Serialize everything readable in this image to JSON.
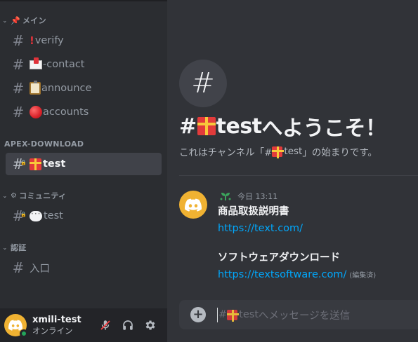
{
  "sidebar": {
    "categories": [
      {
        "label": "メイン",
        "emoji": "pushpin-icon"
      },
      {
        "label": "APEX-DOWNLOAD"
      },
      {
        "label": "コミュニティ",
        "emoji": "gear-icon"
      },
      {
        "label": "認証"
      }
    ],
    "channels": {
      "verify": {
        "label": "verify",
        "emoji": "exclamation-icon"
      },
      "contact": {
        "label": "-contact",
        "emoji": "envelope-icon"
      },
      "announce": {
        "label": "announce",
        "emoji": "clipboard-icon"
      },
      "accounts": {
        "label": "accounts",
        "emoji": "red-circle-icon"
      },
      "test_apex": {
        "label": "test",
        "emoji": "gift-icon"
      },
      "test_community": {
        "label": "test",
        "emoji": "speech-bubble-icon"
      },
      "entrance": {
        "label": "入口"
      }
    }
  },
  "user_panel": {
    "username": "xmili-test",
    "status": "オンライン"
  },
  "main": {
    "welcome_title_prefix": "#",
    "welcome_title_channel": "test",
    "welcome_title_suffix": "へようこそ！",
    "welcome_sub_prefix": "これはチャンネル「#",
    "welcome_sub_channel": "test",
    "welcome_sub_suffix": "」の始まりです。",
    "message": {
      "timestamp": "今日 13:11",
      "lines": [
        {
          "text": "商品取扱説明書"
        },
        {
          "text": "https://text.com/"
        },
        {
          "text": "ソフトウェアダウンロード"
        },
        {
          "text": "https://textsoftware.com/"
        }
      ],
      "edited": "(編集済)"
    },
    "composer": {
      "placeholder_prefix": "#",
      "placeholder_channel": "test",
      "placeholder_suffix": "へメッセージを送信"
    }
  },
  "colors": {
    "sidebar_bg": "#2b2d31",
    "main_bg": "#313338",
    "selected_bg": "#404249",
    "link": "#00a8fc",
    "online": "#23a55a",
    "avatar": "#f0b232"
  }
}
